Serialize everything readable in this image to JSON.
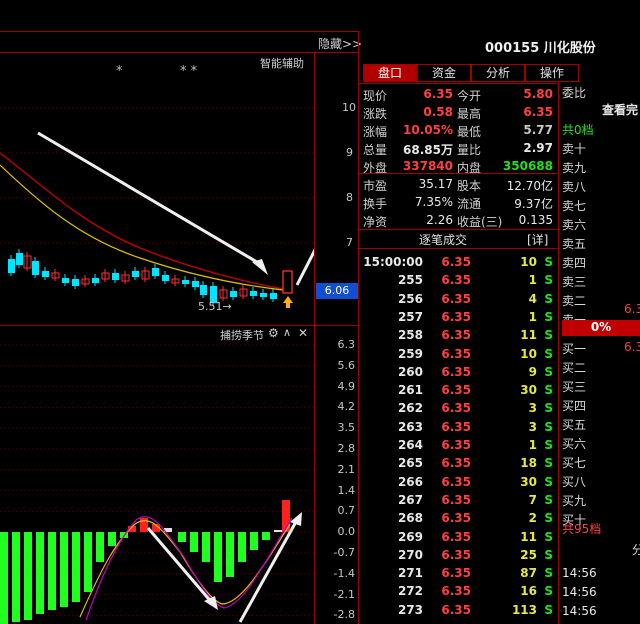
{
  "header": {
    "stock_title": "000155 川化股份",
    "hide_label": "隐藏>>",
    "assist_label": "智能辅助"
  },
  "tabs": [
    "盘口",
    "资金",
    "分析",
    "操作"
  ],
  "chart": {
    "stars_left": "*",
    "stars_right": "* *",
    "price_axis": [
      "10",
      "9",
      "8",
      "7"
    ],
    "current_price_tag": "6.06",
    "low_label": "5.51→",
    "indicator_title": "捕捞季节",
    "indicator_axis": [
      "6.3",
      "5.6",
      "4.9",
      "4.2",
      "3.5",
      "2.8",
      "2.1",
      "1.4",
      "0.7",
      "0.0",
      "-0.7",
      "-1.4",
      "-2.1",
      "-2.8"
    ],
    "colors": {
      "up": "#ff3030",
      "down": "#00e5ff",
      "ma1": "#c00000",
      "ma2": "#e0c000",
      "macd_pos": "#ff2020",
      "macd_neg": "#20ff20"
    }
  },
  "quote": {
    "rows": [
      {
        "l1": "现价",
        "v1": "6.35",
        "c1": "#ff4040",
        "l2": "今开",
        "v2": "5.80",
        "c2": "#ff4040"
      },
      {
        "l1": "涨跌",
        "v1": "0.58",
        "c1": "#ff4040",
        "l2": "最高",
        "v2": "6.35",
        "c2": "#ff4040"
      },
      {
        "l1": "涨幅",
        "v1": "10.05%",
        "c1": "#ff4040",
        "l2": "最低",
        "v2": "5.77",
        "c2": "#c8c8c8"
      },
      {
        "l1": "总量",
        "v1": "68.85万",
        "c1": "#e8e8e8",
        "l2": "量比",
        "v2": "2.97",
        "c2": "#e8e8e8"
      },
      {
        "l1": "外盘",
        "v1": "337840",
        "c1": "#ff4040",
        "l2": "内盘",
        "v2": "350688",
        "c2": "#20e020"
      }
    ],
    "rows2": [
      {
        "l1": "市盈",
        "v1": "35.17",
        "l2": "股本",
        "v2": "12.70亿"
      },
      {
        "l1": "换手",
        "v1": "7.35%",
        "l2": "流通",
        "v2": "9.37亿"
      },
      {
        "l1": "净资",
        "v1": "2.26",
        "l2": "收益(三)",
        "v2": "0.135"
      }
    ]
  },
  "ticks": {
    "title": "逐笔成交",
    "detail": "[详]",
    "rows": [
      {
        "t": "15:00:00",
        "p": "6.35",
        "v": "10",
        "s": "S"
      },
      {
        "t": "255",
        "p": "6.35",
        "v": "1",
        "s": "S"
      },
      {
        "t": "256",
        "p": "6.35",
        "v": "4",
        "s": "S"
      },
      {
        "t": "257",
        "p": "6.35",
        "v": "1",
        "s": "S"
      },
      {
        "t": "258",
        "p": "6.35",
        "v": "11",
        "s": "S"
      },
      {
        "t": "259",
        "p": "6.35",
        "v": "10",
        "s": "S"
      },
      {
        "t": "260",
        "p": "6.35",
        "v": "9",
        "s": "S"
      },
      {
        "t": "261",
        "p": "6.35",
        "v": "30",
        "s": "S"
      },
      {
        "t": "262",
        "p": "6.35",
        "v": "3",
        "s": "S"
      },
      {
        "t": "263",
        "p": "6.35",
        "v": "3",
        "s": "S"
      },
      {
        "t": "264",
        "p": "6.35",
        "v": "1",
        "s": "S"
      },
      {
        "t": "265",
        "p": "6.35",
        "v": "18",
        "s": "S"
      },
      {
        "t": "266",
        "p": "6.35",
        "v": "30",
        "s": "S"
      },
      {
        "t": "267",
        "p": "6.35",
        "v": "7",
        "s": "S"
      },
      {
        "t": "268",
        "p": "6.35",
        "v": "2",
        "s": "S"
      },
      {
        "t": "269",
        "p": "6.35",
        "v": "11",
        "s": "S"
      },
      {
        "t": "270",
        "p": "6.35",
        "v": "25",
        "s": "S"
      },
      {
        "t": "271",
        "p": "6.35",
        "v": "87",
        "s": "S"
      },
      {
        "t": "272",
        "p": "6.35",
        "v": "16",
        "s": "S"
      },
      {
        "t": "273",
        "p": "6.35",
        "v": "113",
        "s": "S"
      }
    ]
  },
  "orderbook": {
    "ratio_label": "委比",
    "view_label": "查看完",
    "top_count": "共0档",
    "sells": [
      "卖十",
      "卖九",
      "卖八",
      "卖七",
      "卖六",
      "卖五",
      "卖四",
      "卖三",
      "卖二",
      "卖一"
    ],
    "sell1_price": "6.3",
    "ratio_value": "0%",
    "buys": [
      "买一",
      "买二",
      "买三",
      "买四",
      "买五",
      "买六",
      "买七",
      "买八",
      "买九",
      "买十"
    ],
    "buy1_price": "6.3",
    "bottom_count": "共95档",
    "split_label": "分",
    "times": [
      "14:56",
      "14:56",
      "14:56"
    ]
  }
}
